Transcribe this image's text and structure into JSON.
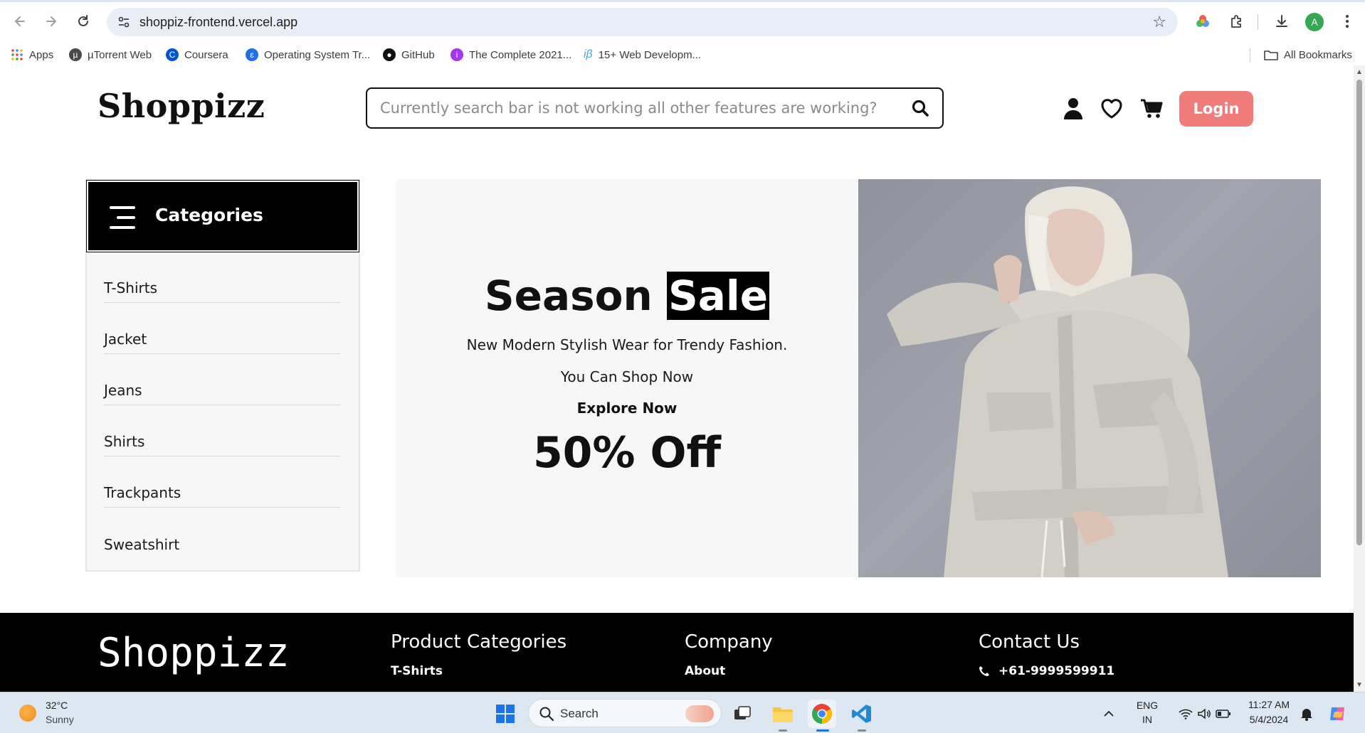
{
  "browser": {
    "url": "shoppiz-frontend.vercel.app",
    "profile_initial": "A",
    "bookmarks": [
      {
        "label": "Apps",
        "icon": "apps-grid-icon"
      },
      {
        "label": "µTorrent Web",
        "icon": "utorrent-icon"
      },
      {
        "label": "Coursera",
        "icon": "coursera-icon"
      },
      {
        "label": "Operating System Tr...",
        "icon": "os-tracker-icon"
      },
      {
        "label": "GitHub",
        "icon": "github-icon"
      },
      {
        "label": "The Complete 2021...",
        "icon": "course-icon"
      },
      {
        "label": "15+ Web Developm...",
        "icon": "ib-icon"
      }
    ],
    "all_bookmarks": "All Bookmarks"
  },
  "header": {
    "logo": "Shoppizz",
    "search_placeholder": "Currently search bar is not working all other features are working?",
    "login_label": "Login"
  },
  "sidebar": {
    "title": "Categories",
    "items": [
      "T-Shirts",
      "Jacket",
      "Jeans",
      "Shirts",
      "Trackpants",
      "Sweatshirt"
    ]
  },
  "hero": {
    "title_plain": "Season ",
    "title_highlight": "Sale",
    "line1": "New Modern Stylish Wear for Trendy Fashion.",
    "line2": "You Can Shop Now",
    "cta": "Explore Now",
    "discount": "50% Off"
  },
  "footer": {
    "logo": "Shoppizz",
    "columns": [
      {
        "title": "Product Categories",
        "first_link": "T-Shirts"
      },
      {
        "title": "Company",
        "first_link": "About"
      },
      {
        "title": "Contact Us",
        "first_link": "+61-9999599911"
      }
    ]
  },
  "taskbar": {
    "temperature": "32°C",
    "weather": "Sunny",
    "search_label": "Search",
    "lang_top": "ENG",
    "lang_bottom": "IN",
    "time": "11:27 AM",
    "date": "5/4/2024"
  },
  "colors": {
    "login_button": "#f07b7b",
    "omnibox": "#e9eef6",
    "taskbar": "#dde7f2"
  }
}
